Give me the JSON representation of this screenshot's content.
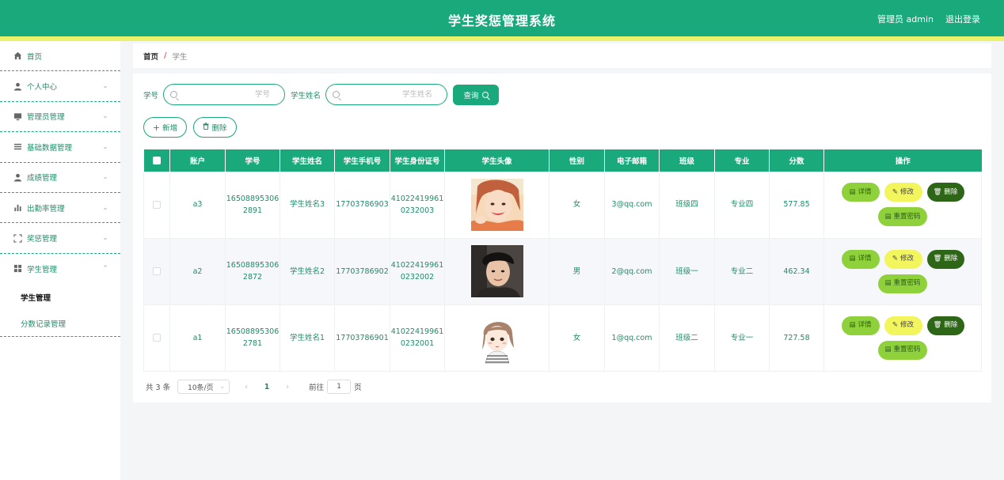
{
  "header": {
    "title": "学生奖惩管理系统",
    "user": "管理员 admin",
    "logout": "退出登录"
  },
  "sidebar": {
    "items": [
      {
        "label": "首页",
        "icon": "home-icon"
      },
      {
        "label": "个人中心",
        "icon": "user-icon"
      },
      {
        "label": "管理员管理",
        "icon": "monitor-icon"
      },
      {
        "label": "基础数据管理",
        "icon": "list-icon"
      },
      {
        "label": "成绩管理",
        "icon": "user-icon"
      },
      {
        "label": "出勤率管理",
        "icon": "bar-chart-icon"
      },
      {
        "label": "奖惩管理",
        "icon": "frame-icon"
      },
      {
        "label": "学生管理",
        "icon": "grid-icon"
      }
    ],
    "submenu": [
      {
        "label": "学生管理",
        "active": true
      },
      {
        "label": "分数记录管理",
        "active": false
      }
    ]
  },
  "breadcrumb": {
    "home": "首页",
    "separator": "/",
    "current": "学生"
  },
  "search": {
    "field1_label": "学号",
    "field1_placeholder": "学号",
    "field2_label": "学生姓名",
    "field2_placeholder": "学生姓名",
    "query_label": "查询"
  },
  "actions": {
    "add_label": "新增",
    "delete_label": "删除"
  },
  "table": {
    "headers": [
      "账户",
      "学号",
      "学生姓名",
      "学生手机号",
      "学生身份证号",
      "学生头像",
      "性别",
      "电子邮箱",
      "班级",
      "专业",
      "分数",
      "操作"
    ],
    "rows": [
      {
        "account": "a3",
        "student_no": "165088953062891",
        "name": "学生姓名3",
        "phone": "17703786903",
        "id_card": "410224199610232003",
        "avatar": "girl-photo",
        "gender": "女",
        "email": "3@qq.com",
        "class": "班级四",
        "major": "专业四",
        "score": "577.85"
      },
      {
        "account": "a2",
        "student_no": "165088953062872",
        "name": "学生姓名2",
        "phone": "17703786902",
        "id_card": "410224199610232002",
        "avatar": "boy-photo",
        "gender": "男",
        "email": "2@qq.com",
        "class": "班级一",
        "major": "专业二",
        "score": "462.34"
      },
      {
        "account": "a1",
        "student_no": "165088953062781",
        "name": "学生姓名1",
        "phone": "17703786901",
        "id_card": "410224199610232001",
        "avatar": "cartoon-girl",
        "gender": "女",
        "email": "1@qq.com",
        "class": "班级二",
        "major": "专业一",
        "score": "727.58"
      }
    ],
    "op_labels": {
      "detail": "详情",
      "edit": "修改",
      "delete": "删除",
      "reset": "重置密码"
    }
  },
  "pagination": {
    "total": "共 3 条",
    "page_size": "10条/页",
    "current_page": "1",
    "goto_label": "前往",
    "goto_value": "1",
    "page_suffix": "页"
  },
  "colors": {
    "primary": "#1aa97b",
    "accent_strip": "#e9f26a",
    "detail_btn": "#8fd13b",
    "edit_btn": "#f3f55d",
    "delete_btn": "#2d6617"
  }
}
